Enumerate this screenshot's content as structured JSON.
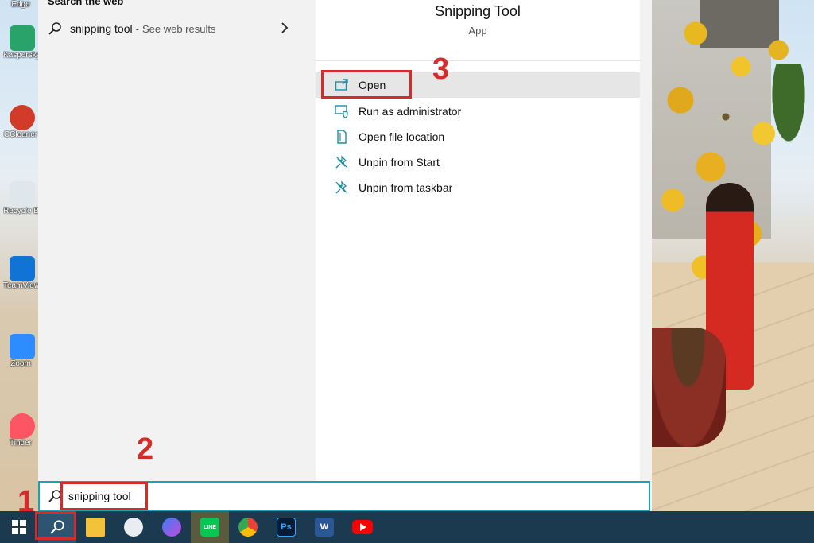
{
  "desktop": {
    "icons": [
      {
        "label": "Edge",
        "icon": "edge-icon"
      },
      {
        "label": "Kaspersky Total Security",
        "icon": "kaspersky-icon"
      },
      {
        "label": "CCleaner",
        "icon": "ccleaner-icon"
      },
      {
        "label": "Recycle Bin",
        "icon": "recycle-bin-icon"
      },
      {
        "label": "TeamViewer",
        "icon": "teamviewer-icon"
      },
      {
        "label": "Zoom",
        "icon": "zoom-icon"
      },
      {
        "label": "Tinder",
        "icon": "tinder-icon"
      }
    ]
  },
  "search_panel": {
    "left": {
      "section_header": "Search the web",
      "web_result": {
        "title": "snipping tool",
        "separator": "-",
        "hint": "See web results"
      }
    },
    "right": {
      "app_title": "Snipping Tool",
      "app_type": "App",
      "actions": [
        {
          "label": "Open",
          "icon": "open-window-icon"
        },
        {
          "label": "Run as administrator",
          "icon": "shield-window-icon"
        },
        {
          "label": "Open file location",
          "icon": "file-location-icon"
        },
        {
          "label": "Unpin from Start",
          "icon": "unpin-icon"
        },
        {
          "label": "Unpin from taskbar",
          "icon": "unpin-icon"
        }
      ]
    }
  },
  "search_box": {
    "value": "snipping tool"
  },
  "annotations": {
    "step1": "1",
    "step2": "2",
    "step3": "3"
  },
  "taskbar": {
    "ps_label": "Ps",
    "word_label": "W",
    "line_label": "LINE"
  },
  "colors": {
    "accent": "#1aa3b5",
    "annotation": "#d62b2b",
    "taskbar": "#1c3a4f"
  }
}
